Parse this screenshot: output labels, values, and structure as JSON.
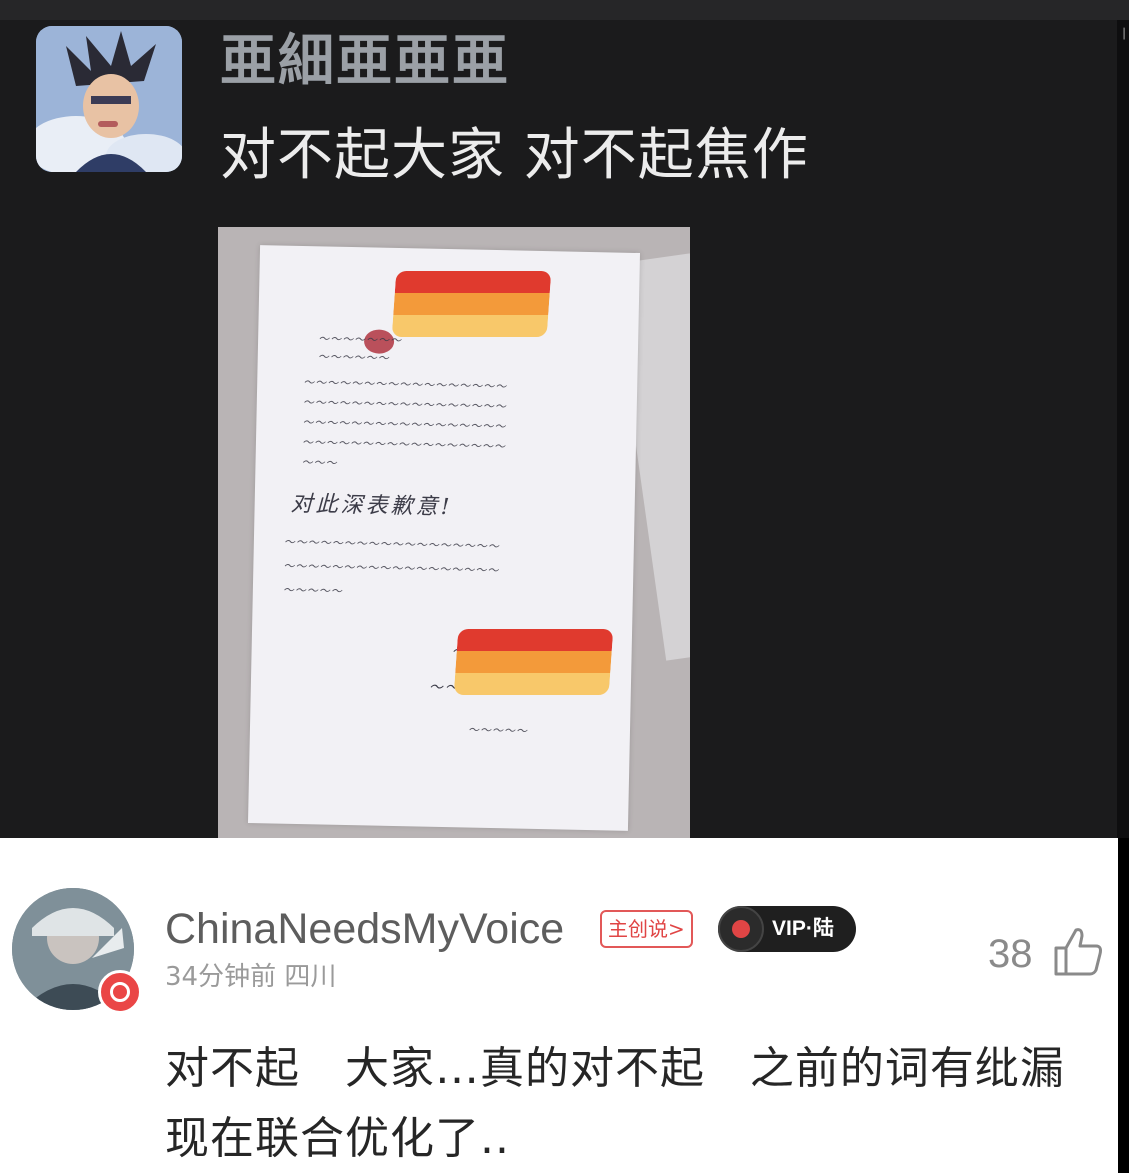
{
  "post": {
    "username": "亜細亜亜亜",
    "message": "对不起大家 对不起焦作"
  },
  "letter": {
    "apology_line": "对此深表歉意!"
  },
  "comment": {
    "username": "ChinaNeedsMyVoice",
    "creator_tag": "主创说>",
    "vip_label": "VIP·陆",
    "time": "34分钟前",
    "location": "四川",
    "like_count": "38",
    "text_line1": "对不起   大家…真的对不起   之前的词有纰漏",
    "text_line2": "现在联合优化了..",
    "icons": [
      "music-disc-icon",
      "thumbs-up-icon",
      "music-badge-icon"
    ]
  },
  "colors": {
    "dark_bg": "#1b1b1c",
    "accent_red": "#e04545",
    "censor_red": "#e03a2e",
    "censor_orange": "#f39a3a",
    "censor_yellow": "#f8c86a"
  }
}
